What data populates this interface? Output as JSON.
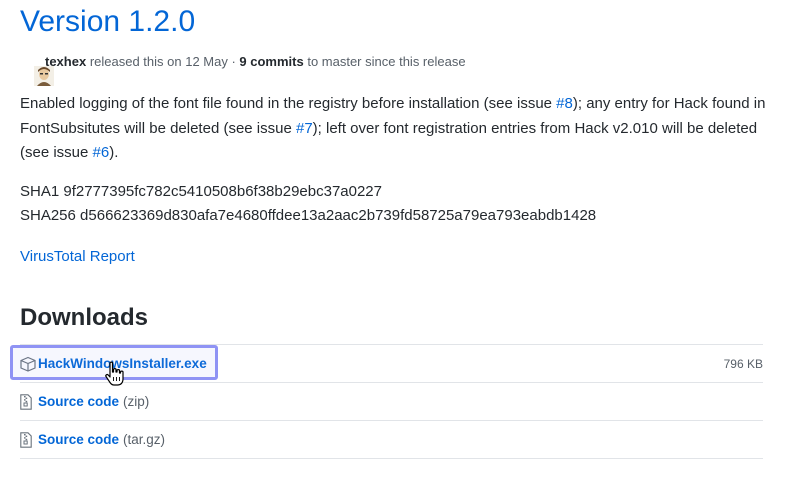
{
  "release": {
    "title": "Version 1.2.0",
    "author": "texhex",
    "released_text": " released this on 12 May · ",
    "commits": "9 commits",
    "commits_suffix": " to master since this release"
  },
  "description": {
    "part1": "Enabled logging of the font file found in the registry before installation (see issue ",
    "issue1": "#8",
    "part2": "); any entry for Hack found in FontSubsitutes will be deleted (see issue ",
    "issue2": "#7",
    "part3": "); left over font registration entries from Hack v2.010 will be deleted (see issue ",
    "issue3": "#6",
    "part4": ")."
  },
  "hashes": {
    "sha1": "SHA1 9f2777395fc782c5410508b6f38b29ebc37a0227",
    "sha256": "SHA256 d566623369d830afa7e4680ffdee13a2aac2b739fd58725a79ea793eabdb1428"
  },
  "virustotal_label": "VirusTotal Report",
  "downloads": {
    "heading": "Downloads",
    "assets": [
      {
        "name": "HackWindowsInstaller.exe",
        "size": "796 KB",
        "icon": "package-icon"
      },
      {
        "name": "Source code",
        "format": "(zip)",
        "icon": "file-zip-icon"
      },
      {
        "name": "Source code",
        "format": "(tar.gz)",
        "icon": "file-zip-icon"
      }
    ]
  },
  "colors": {
    "link": "#0366d6",
    "text": "#24292e",
    "muted": "#586069",
    "highlight_border": "#8f93f4"
  }
}
